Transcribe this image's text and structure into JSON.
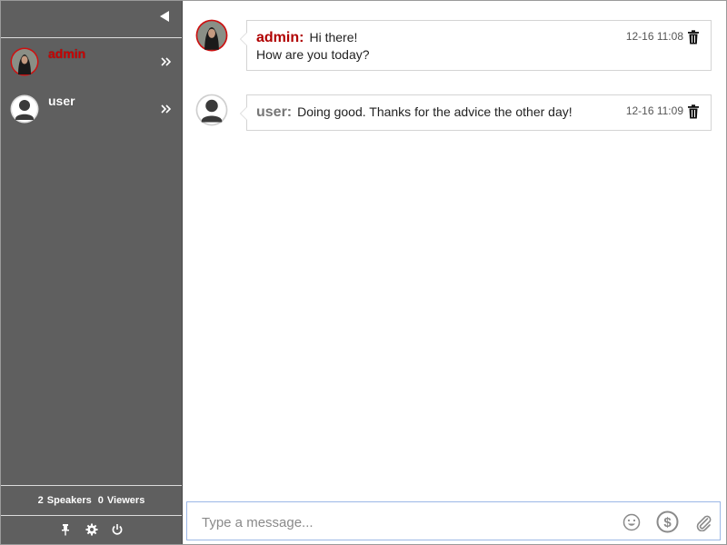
{
  "sidebar": {
    "users": [
      {
        "name": "admin",
        "color": "#cc0000",
        "role": "speaker"
      },
      {
        "name": "user",
        "color": "#ffffff",
        "role": "speaker"
      }
    ],
    "stats": {
      "speakers_count": "2",
      "speakers_label": "Speakers",
      "viewers_count": "0",
      "viewers_label": "Viewers"
    },
    "tools": [
      "pin-icon",
      "gear-icon",
      "power-icon"
    ]
  },
  "messages": [
    {
      "sender": "admin:",
      "sender_color": "#b00000",
      "line1": "Hi there!",
      "line2": "How are you today?",
      "time": "12-16 11:08"
    },
    {
      "sender": "user:",
      "sender_color": "#777777",
      "line1": "Doing good. Thanks for the advice the other day!",
      "time": "12-16 11:09"
    }
  ],
  "composer": {
    "placeholder": "Type a message...",
    "icons": [
      "emoji-icon",
      "dollar-icon",
      "attach-icon"
    ]
  }
}
